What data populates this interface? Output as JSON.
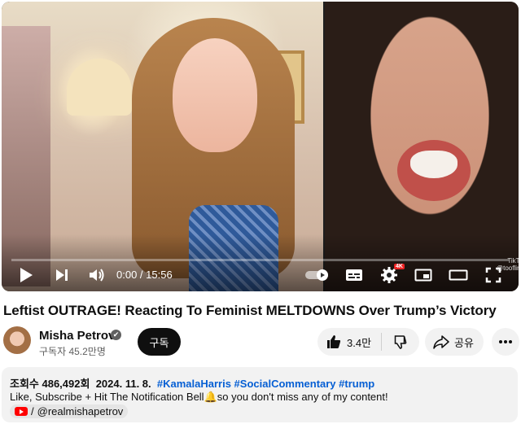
{
  "player": {
    "time_display": "0:00 / 15:56",
    "quality_badge": "4K",
    "progress_fraction": 0,
    "watermark_line1": "TikTok",
    "watermark_line2": "@tooflirthi"
  },
  "video": {
    "title": "Leftist OUTRAGE! Reacting To Feminist MELTDOWNS Over Trump’s Victory"
  },
  "channel": {
    "name": "Misha Petrov",
    "verified_mark": "✔",
    "subscribers": "구독자 45.2만명",
    "subscribe_label": "구독"
  },
  "actions": {
    "like_count": "3.4만",
    "share_label": "공유"
  },
  "description": {
    "views": "조회수 486,492회",
    "date": "2024. 11. 8.",
    "hashtags": "#KamalaHarris #SocialCommentary #trump",
    "line2": "Like, Subscribe + Hit The Notification Bell🔔so you don't miss any of my content!",
    "link_prefix": "/",
    "link_handle": "@realmishapetrov"
  },
  "icons": [
    "play-icon",
    "next-icon",
    "volume-icon",
    "autoplay-toggle-icon",
    "subtitles-icon",
    "settings-icon",
    "miniplayer-icon",
    "theater-icon",
    "fullscreen-icon",
    "verified-icon",
    "thumbs-up-icon",
    "thumbs-down-icon",
    "share-icon",
    "more-icon",
    "youtube-logo-icon"
  ]
}
